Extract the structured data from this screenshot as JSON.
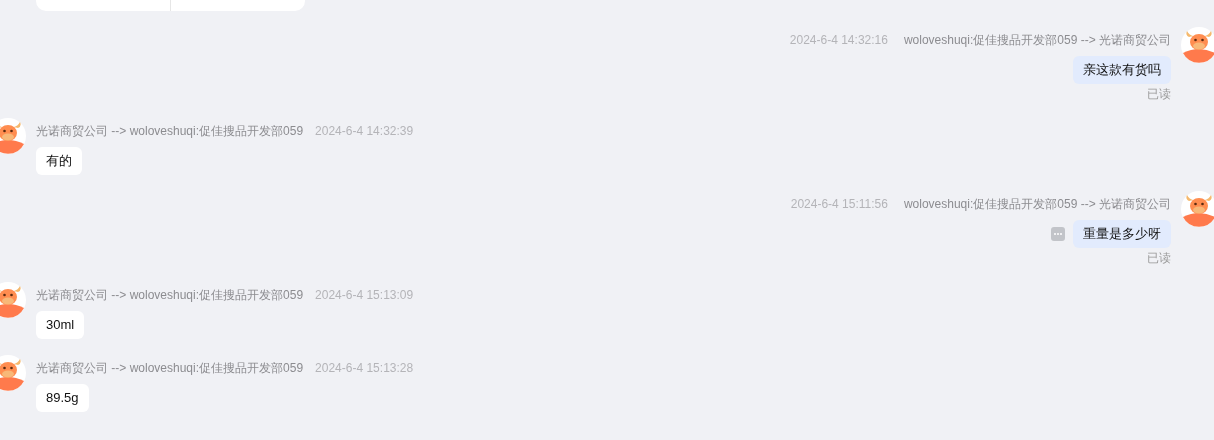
{
  "messages": [
    {
      "kind": "outgoing",
      "time": "2024-6-4 14:32:16",
      "route": "woloveshuqi:促佳搜品开发部059 --> 光诺商贸公司",
      "text": "亲这款有货吗",
      "status": "已读",
      "more_button": false
    },
    {
      "kind": "incoming",
      "time": "2024-6-4 14:32:39",
      "route": "光诺商贸公司 --> woloveshuqi:促佳搜品开发部059",
      "text": "有的",
      "more_button": false
    },
    {
      "kind": "outgoing",
      "time": "2024-6-4 15:11:56",
      "route": "woloveshuqi:促佳搜品开发部059 --> 光诺商贸公司",
      "text": "重量是多少呀",
      "status": "已读",
      "more_button": true
    },
    {
      "kind": "incoming",
      "time": "2024-6-4 15:13:09",
      "route": "光诺商贸公司 --> woloveshuqi:促佳搜品开发部059",
      "text": "30ml",
      "more_button": false
    },
    {
      "kind": "incoming",
      "time": "2024-6-4 15:13:28",
      "route": "光诺商贸公司 --> woloveshuqi:促佳搜品开发部059",
      "text": "89.5g",
      "more_button": false
    }
  ]
}
